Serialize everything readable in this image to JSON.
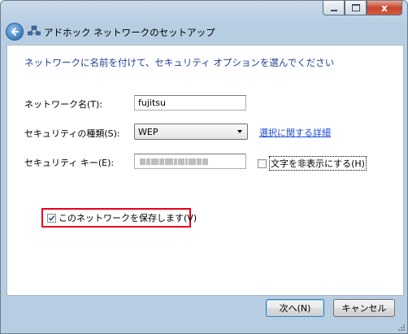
{
  "window": {
    "title": "アドホック ネットワークのセットアップ",
    "close_glyph": "x"
  },
  "page": {
    "heading": "ネットワークに名前を付けて、セキュリティ オプションを選んでください"
  },
  "form": {
    "network_name_label": "ネットワーク名(T):",
    "network_name_value": "fujitsu",
    "security_type_label": "セキュリティの種類(S):",
    "security_type_value": "WEP",
    "security_detail_link": "選択に関する詳細",
    "security_key_label": "セキュリティ キー(E):",
    "hide_chars_label": "文字を非表示にする(H)",
    "hide_chars_checked": false,
    "save_network_label": "このネットワークを保存します(V)",
    "save_network_checked": true
  },
  "buttons": {
    "next": "次へ(N)",
    "cancel": "キャンセル"
  },
  "colors": {
    "heading": "#1e3f9a",
    "link": "#1e4ed6",
    "highlight_frame": "#e8001c"
  }
}
